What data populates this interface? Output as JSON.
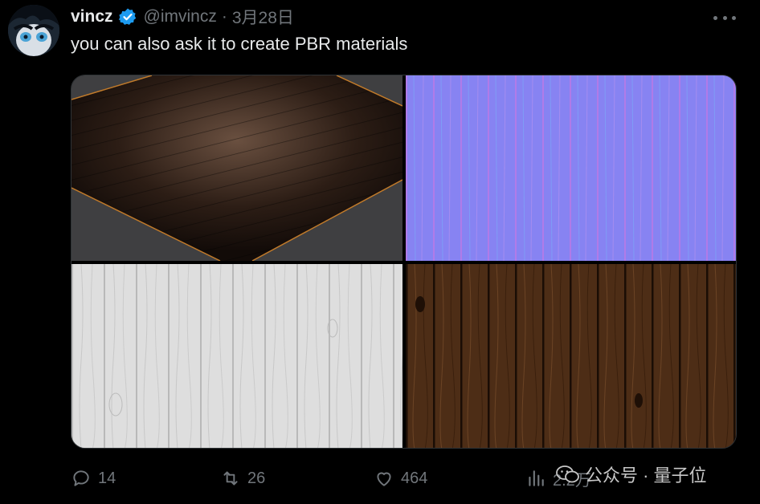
{
  "tweet": {
    "name": "vincz",
    "handle": "@imvincz",
    "separator": "·",
    "date": "3月28日",
    "text": "you can also ask it to create PBR materials"
  },
  "media": {
    "images": [
      {
        "icon": "wood-floor-render"
      },
      {
        "icon": "normal-map"
      },
      {
        "icon": "roughness-map"
      },
      {
        "icon": "albedo-map"
      }
    ]
  },
  "actions": {
    "replies": "14",
    "reposts": "26",
    "likes": "464",
    "views": "2.2万"
  },
  "watermark": {
    "text": "公众号 · 量子位"
  },
  "colors": {
    "background": "#000000",
    "text": "#e7e9ea",
    "muted": "#71767b",
    "verified": "#1d9bf0"
  }
}
